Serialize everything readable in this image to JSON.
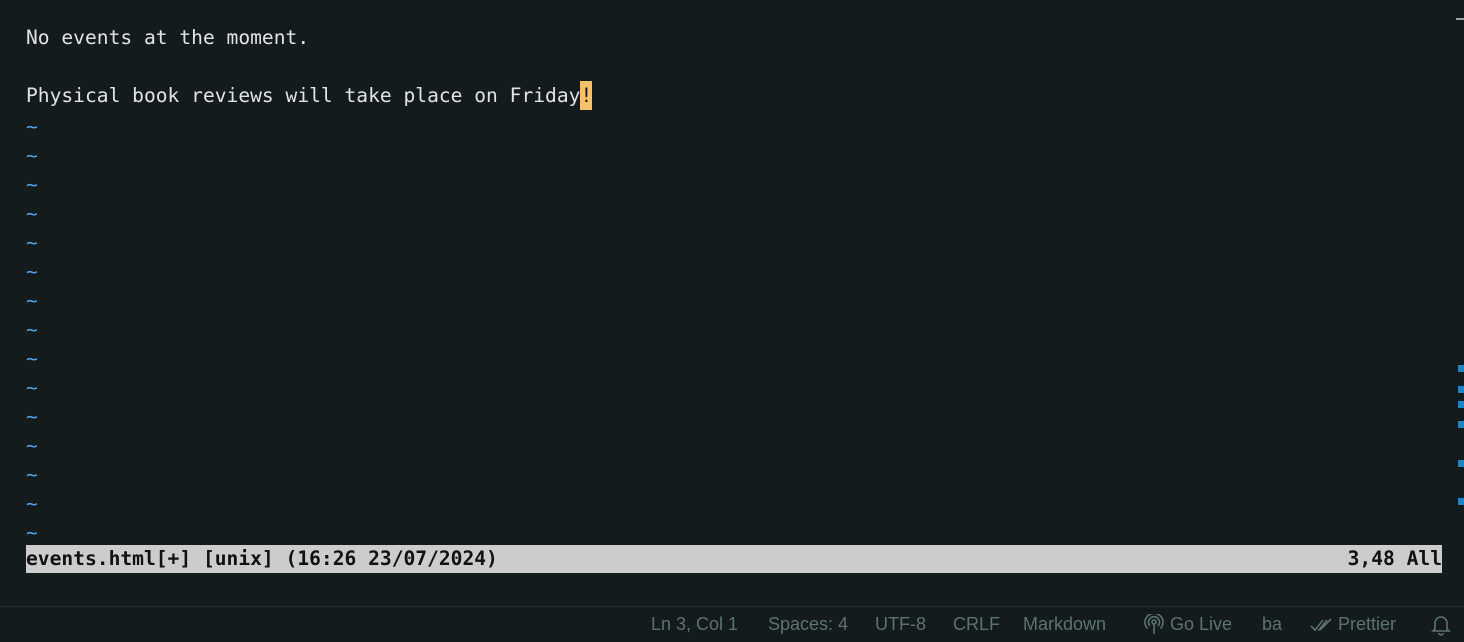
{
  "editor": {
    "lines": [
      {
        "text": "No events at the moment."
      },
      {
        "text": ""
      },
      {
        "text": "Physical book reviews will take place on Friday",
        "cursor_char": "!"
      }
    ],
    "empty_line_marker": "~"
  },
  "vim_status": {
    "left": "events.html[+] [unix] (16:26 23/07/2024)",
    "right": "3,48 All"
  },
  "statusbar": {
    "position": "Ln 3, Col 1",
    "indent": "Spaces: 4",
    "encoding": "UTF-8",
    "eol": "CRLF",
    "language": "Markdown",
    "go_live": "Go Live",
    "ba": "ba",
    "prettier": "Prettier",
    "icons": {
      "go_live": "broadcast-icon",
      "prettier": "double-check-icon",
      "notifications": "bell-icon"
    }
  },
  "colors": {
    "background": "#131b1c",
    "text": "#e3e3e3",
    "tilde": "#4fa3e8",
    "cursor": "#f5c26b",
    "vim_status_bg": "#cccccc",
    "statusbar_text": "#5d7272"
  }
}
